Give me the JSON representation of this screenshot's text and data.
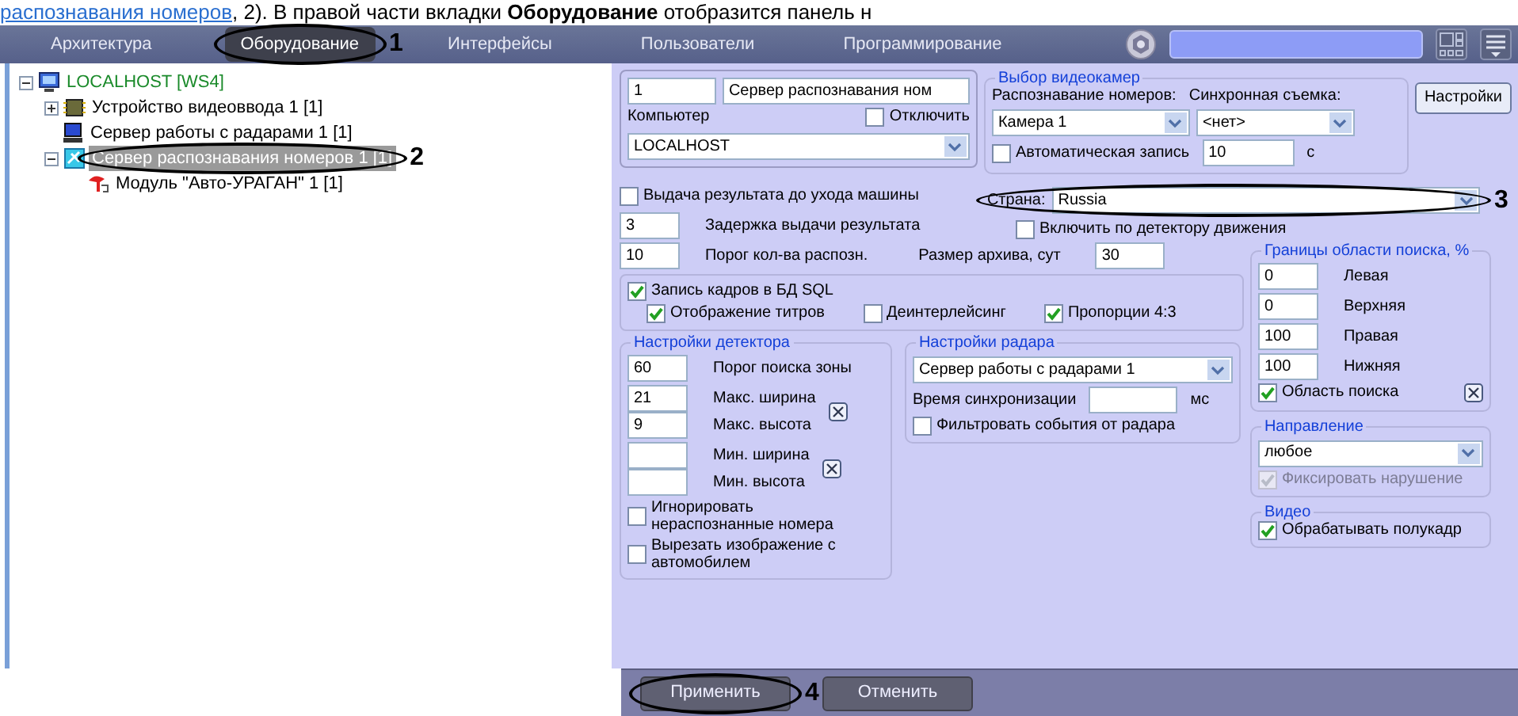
{
  "doc_text": {
    "link": "распознавания номеров",
    "text": ", 2). В правой части вкладки **Оборудование** отобразится панель н"
  },
  "tabs": [
    {
      "label": "Архитектура",
      "selected": false
    },
    {
      "label": "Оборудование",
      "selected": true,
      "callout": "1"
    },
    {
      "label": "Интерфейсы",
      "selected": false
    },
    {
      "label": "Пользователи",
      "selected": false
    },
    {
      "label": "Программирование",
      "selected": false
    }
  ],
  "tree": [
    {
      "label": "LOCALHOST [WS4]",
      "kind": "computer",
      "expanded": true,
      "selected": false,
      "children": [
        {
          "label": "Устройство видеоввода 1 [1]",
          "kind": "capture",
          "expanded": false,
          "selected": false
        },
        {
          "label": "Сервер работы с радарами 1 [1]",
          "kind": "radar",
          "selected": false
        },
        {
          "label": "Сервер распознавания номеров 1 [1]",
          "kind": "recognizer",
          "expanded": true,
          "selected": true,
          "callout": "2",
          "children": [
            {
              "label": "Модуль \"Авто-УРАГАН\" 1 [1]",
              "kind": "module",
              "selected": false
            }
          ]
        }
      ]
    }
  ],
  "settings": {
    "id": "1",
    "name": "Сервер распознавания ном",
    "computer_label": "Компьютер",
    "disable": {
      "label": "Отключить",
      "checked": false
    },
    "computer": "LOCALHOST",
    "cameras": {
      "title": "Выбор видеокамер",
      "recognition_label": "Распознавание номеров:",
      "sync_label": "Синхронная съемка:",
      "recognition": "Камера 1",
      "sync": "<нет>",
      "auto_record": {
        "label": "Автоматическая запись",
        "checked": false
      },
      "auto_record_value": "10",
      "auto_record_unit": "с"
    },
    "settings_button": "Настройки",
    "early_result": {
      "label": "Выдача результата до ухода машины",
      "checked": false
    },
    "delay": {
      "value": "3",
      "label": "Задержка выдачи результата"
    },
    "threshold": {
      "value": "10",
      "label": "Порог кол-ва распозн."
    },
    "country": {
      "label": "Страна:",
      "value": "Russia",
      "callout": "3"
    },
    "motion": {
      "label": "Включить по детектору движения",
      "checked": false
    },
    "archive": {
      "label": "Размер архива, сут",
      "value": "30"
    },
    "sql": {
      "label": "Запись кадров в БД SQL",
      "checked": true
    },
    "sql_options": [
      {
        "label": "Отображение титров",
        "checked": true
      },
      {
        "label": "Деинтерлейсинг",
        "checked": false
      },
      {
        "label": "Пропорции 4:3",
        "checked": true
      }
    ],
    "detector": {
      "title": "Настройки детектора",
      "zone": {
        "value": "60",
        "label": "Порог поиска зоны"
      },
      "max": [
        {
          "value": "21",
          "label": "Макс. ширина"
        },
        {
          "value": "9",
          "label": "Макс. высота"
        }
      ],
      "min": [
        {
          "label": "Мин. ширина"
        },
        {
          "label": "Мин. высота"
        }
      ],
      "options": [
        {
          "label": "Игнорировать нераспознанные номера",
          "checked": false
        },
        {
          "label": "Вырезать изображение с автомобилем",
          "checked": false
        }
      ]
    },
    "radar": {
      "title": "Настройки радара",
      "server": "Сервер работы с радарами 1",
      "sync_label": "Время синхронизации",
      "sync_unit": "мс",
      "filter": {
        "label": "Фильтровать события от радара",
        "checked": false
      }
    },
    "bounds": {
      "title": "Границы области поиска, %",
      "fields": [
        {
          "value": "0",
          "label": "Левая"
        },
        {
          "value": "0",
          "label": "Верхняя"
        },
        {
          "value": "100",
          "label": "Правая"
        },
        {
          "value": "100",
          "label": "Нижняя"
        }
      ],
      "area": {
        "label": "Область поиска",
        "checked": true
      }
    },
    "direction": {
      "title": "Направление",
      "value": "любое",
      "fix": {
        "label": "Фиксировать нарушение",
        "checked": true,
        "disabled": true
      }
    },
    "video": {
      "title": "Видео",
      "half_frame": {
        "label": "Обрабатывать полукадр",
        "checked": true
      }
    }
  },
  "footer_buttons": [
    {
      "label": "Применить",
      "callout": "4"
    },
    {
      "label": "Отменить"
    }
  ]
}
